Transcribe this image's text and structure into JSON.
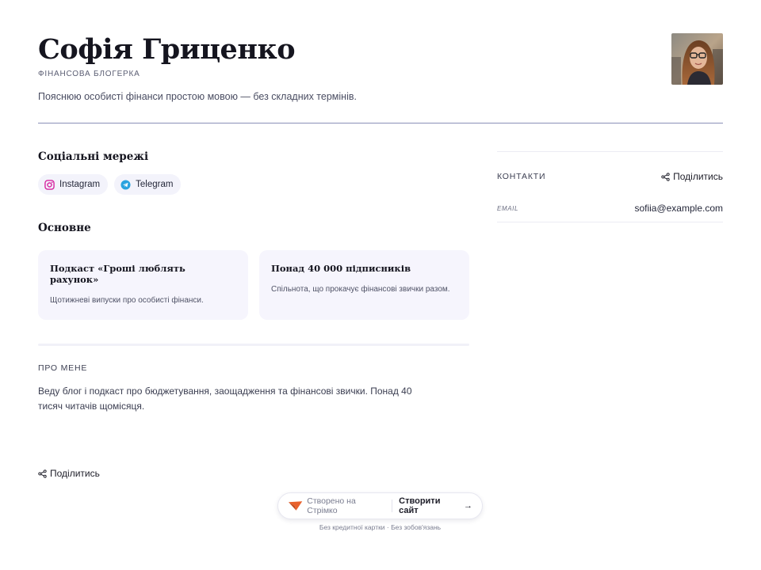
{
  "profile": {
    "name": "Софія Гриценко",
    "role": "ФІНАНСОВА БЛОГЕРКА",
    "tagline": "Пояснюю особисті фінанси простою мовою — без складних термінів."
  },
  "social": {
    "title": "Соціальні мережі",
    "items": [
      {
        "label": "Instagram",
        "icon": "instagram-icon",
        "color": "#d6249f"
      },
      {
        "label": "Telegram",
        "icon": "telegram-icon",
        "color": "#2aa3df"
      }
    ]
  },
  "basic": {
    "title": "Основне",
    "cards": [
      {
        "title": "Подкаст «Гроші люблять рахунок»",
        "desc": "Щотижневі випуски про особисті фінанси."
      },
      {
        "title": "Понад 40 000 підписників",
        "desc": "Спільнота, що прокачує фінансові звички разом."
      }
    ]
  },
  "about": {
    "label": "ПРО МЕНЕ",
    "text": "Веду блог і подкаст про бюджетування, заощадження та фінансові звички. Понад 40 тисяч читачів щомісяця."
  },
  "contacts": {
    "label": "КОНТАКТИ",
    "share_label": "Поділитись",
    "rows": [
      {
        "key": "EMAIL",
        "value": "sofiia@example.com"
      }
    ]
  },
  "footer": {
    "share_label": "Поділитись",
    "made_with": "Створено на Стрімко",
    "cta": "Створити сайт",
    "arrow": "→",
    "note": "Без кредитної картки · Без зобов'язань"
  },
  "colors": {
    "accent": "#e8612c",
    "card_bg": "#f6f5fd",
    "divider": "#8a8fb8"
  }
}
